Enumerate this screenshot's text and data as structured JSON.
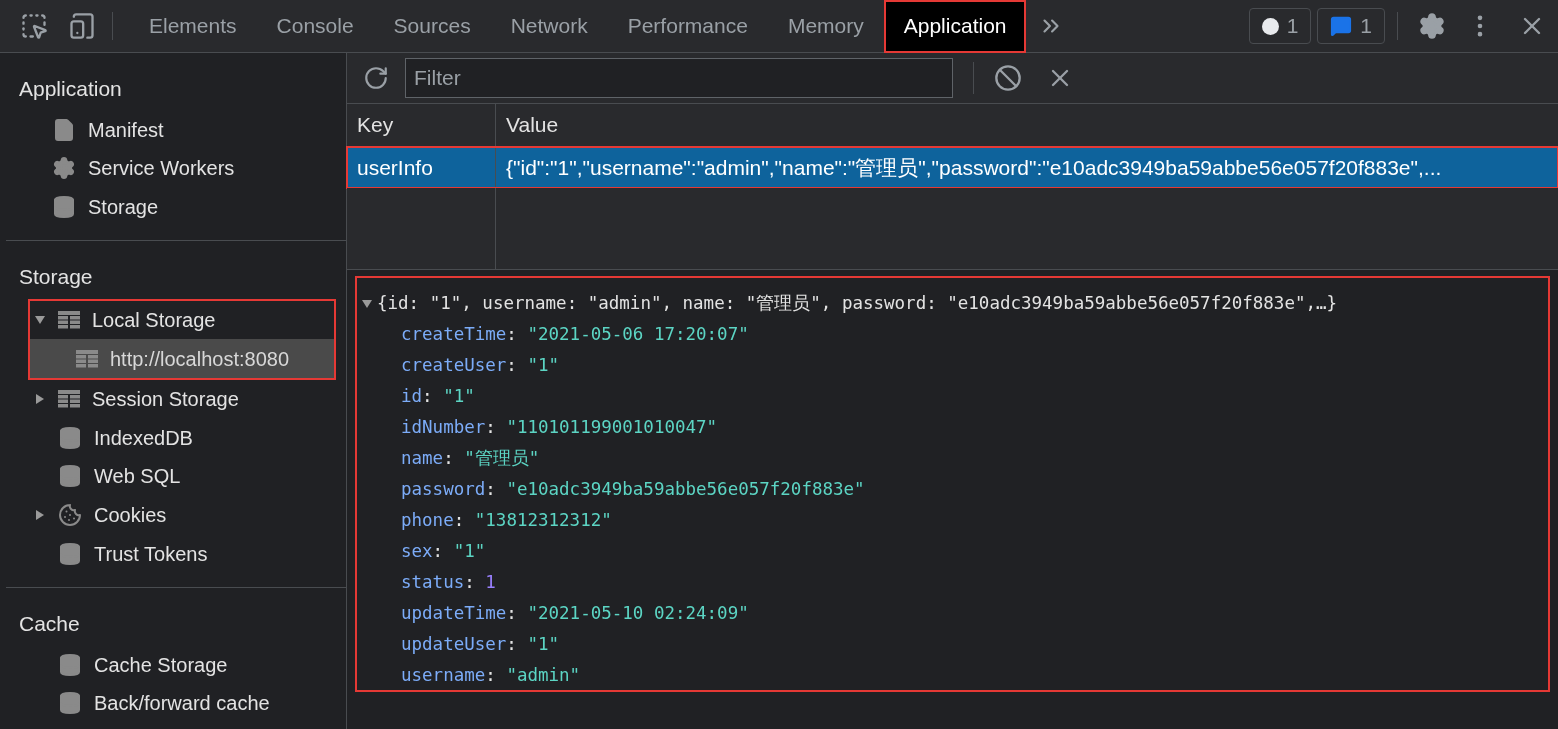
{
  "toolbar": {
    "tabs": [
      {
        "label": "Elements",
        "selected": false,
        "highlighted": false
      },
      {
        "label": "Console",
        "selected": false,
        "highlighted": false
      },
      {
        "label": "Sources",
        "selected": false,
        "highlighted": false
      },
      {
        "label": "Network",
        "selected": false,
        "highlighted": false
      },
      {
        "label": "Performance",
        "selected": false,
        "highlighted": false
      },
      {
        "label": "Memory",
        "selected": false,
        "highlighted": false
      },
      {
        "label": "Application",
        "selected": true,
        "highlighted": true
      }
    ],
    "issues_count": "1",
    "messages_count": "1"
  },
  "sidebar": {
    "sections": [
      {
        "title": "Application",
        "items": [
          {
            "label": "Manifest",
            "kind": "file"
          },
          {
            "label": "Service Workers",
            "kind": "gear"
          },
          {
            "label": "Storage",
            "kind": "database"
          }
        ]
      },
      {
        "title": "Storage",
        "items": [
          {
            "label": "Local Storage",
            "kind": "table",
            "expanded": true,
            "highlighted": true,
            "children": [
              {
                "label": "http://localhost:8080",
                "kind": "table",
                "selected": true
              }
            ]
          },
          {
            "label": "Session Storage",
            "kind": "table",
            "expanded": false,
            "highlighted": false
          },
          {
            "label": "IndexedDB",
            "kind": "database"
          },
          {
            "label": "Web SQL",
            "kind": "database"
          },
          {
            "label": "Cookies",
            "kind": "cookie",
            "expanded": false,
            "highlighted": false
          },
          {
            "label": "Trust Tokens",
            "kind": "database"
          }
        ]
      },
      {
        "title": "Cache",
        "items": [
          {
            "label": "Cache Storage",
            "kind": "database"
          },
          {
            "label": "Back/forward cache",
            "kind": "database"
          }
        ]
      }
    ]
  },
  "filter": {
    "placeholder": "Filter"
  },
  "table": {
    "columns": [
      "Key",
      "Value"
    ],
    "rows": [
      {
        "key": "userInfo",
        "value": "{\"id\":\"1\",\"username\":\"admin\",\"name\":\"管理员\",\"password\":\"e10adc3949ba59abbe56e057f20f883e\",...",
        "selected": true,
        "highlighted": true
      }
    ]
  },
  "preview": {
    "separator": ":",
    "summary": "{id: \"1\", username: \"admin\", name: \"管理员\", password: \"e10adc3949ba59abbe56e057f20f883e\",…}",
    "expanded": true,
    "highlighted": true,
    "properties": [
      {
        "key": "createTime",
        "value": "\"2021-05-06 17:20:07\"",
        "kind": "string"
      },
      {
        "key": "createUser",
        "value": "\"1\"",
        "kind": "string"
      },
      {
        "key": "id",
        "value": "\"1\"",
        "kind": "string"
      },
      {
        "key": "idNumber",
        "value": "\"110101199001010047\"",
        "kind": "string"
      },
      {
        "key": "name",
        "value": "\"管理员\"",
        "kind": "string"
      },
      {
        "key": "password",
        "value": "\"e10adc3949ba59abbe56e057f20f883e\"",
        "kind": "string"
      },
      {
        "key": "phone",
        "value": "\"13812312312\"",
        "kind": "string"
      },
      {
        "key": "sex",
        "value": "\"1\"",
        "kind": "string"
      },
      {
        "key": "status",
        "value": "1",
        "kind": "number"
      },
      {
        "key": "updateTime",
        "value": "\"2021-05-10 02:24:09\"",
        "kind": "string"
      },
      {
        "key": "updateUser",
        "value": "\"1\"",
        "kind": "string"
      },
      {
        "key": "username",
        "value": "\"admin\"",
        "kind": "string"
      }
    ]
  }
}
